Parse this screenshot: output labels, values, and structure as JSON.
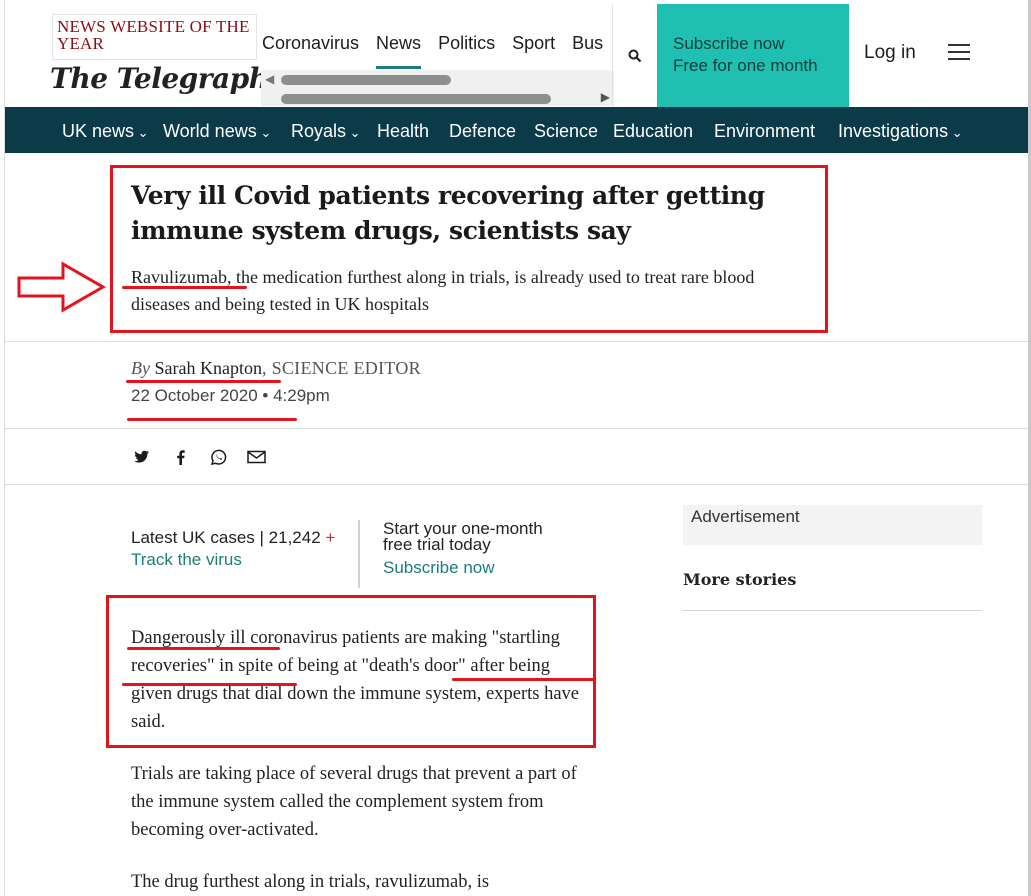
{
  "header": {
    "award_text": "NEWS WEBSITE OF THE YEAR",
    "logo_text": "The Telegraph",
    "topnav": [
      "Coronavirus",
      "News",
      "Politics",
      "Sport",
      "Bus"
    ],
    "active_tab": "News",
    "subscribe_line1": "Subscribe now",
    "subscribe_line2": "Free for one month",
    "login_label": "Log in"
  },
  "section_nav": [
    "UK news",
    "World news",
    "Royals",
    "Health",
    "Defence",
    "Science",
    "Education",
    "Environment",
    "Investigations"
  ],
  "article": {
    "headline": "Very ill Covid patients recovering after getting immune system drugs, scientists say",
    "standfirst_link": "Ravulizumab",
    "standfirst_rest": ", the medication furthest along in trials, is already used to treat rare blood diseases and being tested in UK hospitals",
    "byline_by": "By",
    "author": "Sarah Knapton",
    "role": ", SCIENCE EDITOR",
    "date": "22 October 2020",
    "time": "4:29pm",
    "latest_cases_label": "Latest UK cases",
    "latest_cases_count": "21,242",
    "latest_plus": "+",
    "track_link": "Track the virus",
    "trial_line1": "Start your one-month",
    "trial_line2": "free trial today",
    "trial_link": "Subscribe now",
    "paragraphs": [
      "Dangerously ill coronavirus patients are making \"startling recoveries\" in spite of being at \"death's door\" after being given drugs that dial down the immune system, experts have said.",
      "Trials are taking place of several drugs that prevent a part of the immune system called the complement system from becoming over-activated.",
      "The drug furthest along in trials, ravulizumab, is"
    ]
  },
  "sidebar": {
    "ad_label": "Advertisement",
    "more_stories": "More stories"
  },
  "icons": [
    "search-icon",
    "menu-icon",
    "twitter-icon",
    "facebook-icon",
    "whatsapp-icon",
    "email-icon",
    "chevron-down-icon"
  ],
  "colors": {
    "accent_teal": "#1fbfb1",
    "nav_bg": "#0b3a48",
    "annotation_red": "#e3141c",
    "link_teal": "#1b7f77"
  }
}
